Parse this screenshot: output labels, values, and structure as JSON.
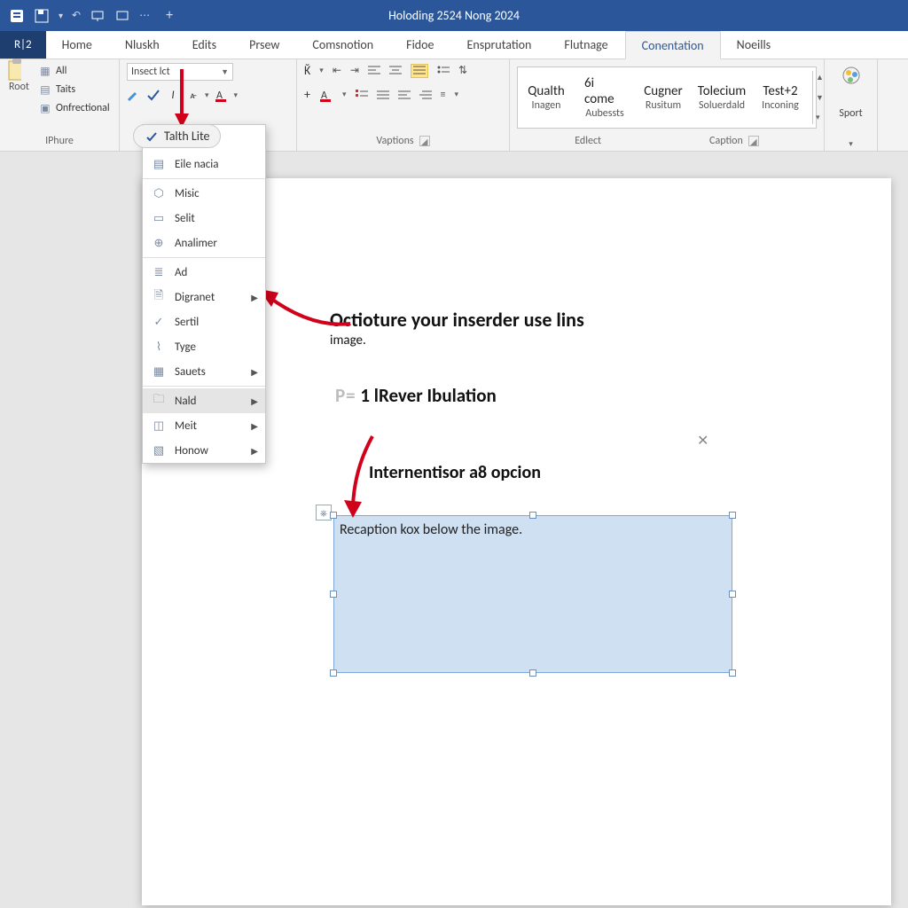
{
  "title": "Holoding 2524 Nong 2024",
  "file_tab": "R|2",
  "tabs": [
    "Home",
    "Nluskh",
    "Edits",
    "Prsew",
    "Comsnotion",
    "Fidoe",
    "Ensprutation",
    "Flutnage",
    "Conentation",
    "Noeills"
  ],
  "active_tab_index": 8,
  "ribbon": {
    "group1": {
      "label": "IPhure",
      "side_label": "Root",
      "items": [
        "All",
        "Taits",
        "Onfrectional"
      ]
    },
    "font_selector": "Insect lct",
    "group_vaptions_label": "Vaptions",
    "group_edict_label": "Edlect",
    "group_caption_label": "Caption",
    "big_buttons": [
      {
        "top": "Qualth",
        "bot": "Inagen"
      },
      {
        "top": "6i come",
        "bot": "Aubessts"
      },
      {
        "top": "Cugner",
        "bot": "Rusitum"
      },
      {
        "top": "Tolecium",
        "bot": "Soluerdald"
      },
      {
        "top": "Test+2",
        "bot": "Inconing"
      }
    ],
    "sport_label": "Sport"
  },
  "dropdown": {
    "header": "Talth Lite",
    "items": [
      {
        "label": "Eile nacia",
        "icon": "page-icon"
      },
      {
        "label": "Misic",
        "icon": "hex-icon",
        "sep_before": true
      },
      {
        "label": "Selit",
        "icon": "rect-icon"
      },
      {
        "label": "Analimer",
        "icon": "globe-icon"
      },
      {
        "label": "Ad",
        "icon": "lines-icon",
        "sep_before": true
      },
      {
        "label": "Digranet",
        "icon": "doc-icon",
        "submenu": true
      },
      {
        "label": "Sertil",
        "icon": "check-icon"
      },
      {
        "label": "Tyge",
        "icon": "tube-icon"
      },
      {
        "label": "Sauets",
        "icon": "grid-icon",
        "submenu": true
      },
      {
        "label": "Nald",
        "icon": "folder-icon",
        "submenu": true,
        "hover": true,
        "sep_before": true
      },
      {
        "label": "Meit",
        "icon": "layout-icon",
        "submenu": true
      },
      {
        "label": "Honow",
        "icon": "image-icon",
        "submenu": true
      }
    ]
  },
  "page": {
    "anno1_line1": "Octioture your inserder use lins",
    "anno1_line2": "image.",
    "heading_prefix": "P=",
    "heading": "1 lRever Ibulation",
    "anno2": "Internentisor a8  opcion",
    "caption_text": "Recaption kox below the image."
  }
}
